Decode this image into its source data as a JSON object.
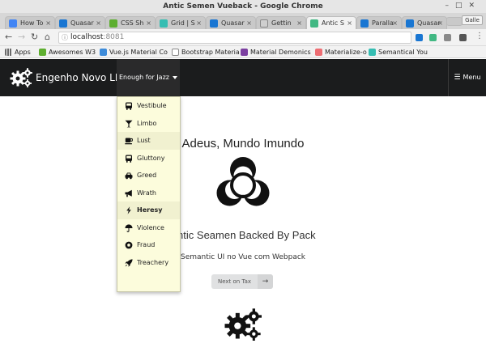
{
  "window": {
    "title": "Antic Semen Vueback - Google Chrome"
  },
  "tabs": [
    {
      "label": "How To",
      "icon": "google-icon",
      "color": "#4285f4",
      "active": false
    },
    {
      "label": "Quasar",
      "icon": "quasar-icon",
      "color": "#1976d2",
      "active": false
    },
    {
      "label": "CSS Sh",
      "icon": "css-icon",
      "color": "#5dae2f",
      "active": false
    },
    {
      "label": "Grid | S",
      "icon": "semantic-icon",
      "color": "#35bdb2",
      "active": false
    },
    {
      "label": "Quasar",
      "icon": "quasar-icon",
      "color": "#1976d2",
      "active": false
    },
    {
      "label": "Gettin",
      "icon": "page-icon",
      "color": "#888888",
      "active": false
    },
    {
      "label": "Antic S",
      "icon": "vue-icon",
      "color": "#41b883",
      "active": true
    },
    {
      "label": "Paralla",
      "icon": "quasar-icon",
      "color": "#1976d2",
      "active": false
    },
    {
      "label": "Quasar",
      "icon": "quasar-icon",
      "color": "#1976d2",
      "active": false
    }
  ],
  "profile_label": "Galle",
  "address": {
    "host": "localhost",
    "port": ":8081"
  },
  "bookmarks": [
    {
      "label": "Apps",
      "icon": "apps-icon",
      "color": "#6a6a6a"
    },
    {
      "label": "Awesomes W3",
      "icon": "w3-icon",
      "color": "#5dae2f"
    },
    {
      "label": "Vue.js Material Co",
      "icon": "vue-material-icon",
      "color": "#3d8bd9"
    },
    {
      "label": "Bootstrap Materia",
      "icon": "page-icon",
      "color": "#888888"
    },
    {
      "label": "Material Demonics",
      "icon": "demonics-icon",
      "color": "#7b3fa0"
    },
    {
      "label": "Materialize-o",
      "icon": "materialize-icon",
      "color": "#ee6e73"
    },
    {
      "label": "Semantical You",
      "icon": "semantic-icon",
      "color": "#35bdb2"
    }
  ],
  "navbar": {
    "brand": "Engenho Novo LLC",
    "dropdown_label": "Enough for Jazz",
    "menu_label": "Menu"
  },
  "dropdown_items": [
    {
      "label": "Vestibule",
      "icon": "bus-icon"
    },
    {
      "label": "Limbo",
      "icon": "cocktail-icon"
    },
    {
      "label": "Lust",
      "icon": "coffee-cup-icon"
    },
    {
      "label": "Gluttony",
      "icon": "bus-icon"
    },
    {
      "label": "Greed",
      "icon": "car-icon"
    },
    {
      "label": "Wrath",
      "icon": "bullhorn-icon"
    },
    {
      "label": "Heresy",
      "icon": "lightning-icon"
    },
    {
      "label": "Violence",
      "icon": "umbrella-icon"
    },
    {
      "label": "Fraud",
      "icon": "soccer-ball-icon"
    },
    {
      "label": "Treachery",
      "icon": "rocket-icon"
    }
  ],
  "content": {
    "title": "Adeus, Mundo Imundo",
    "subtitle": "Antic Seamen Backed By Pack",
    "tagline": "Semantic UI no Vue com Webpack",
    "next_button": "Next on Tax"
  },
  "colors": {
    "navbar": "#1b1c1d",
    "dropdown_bg": "#fcfcdc",
    "button_bg": "#e0e1e2"
  }
}
